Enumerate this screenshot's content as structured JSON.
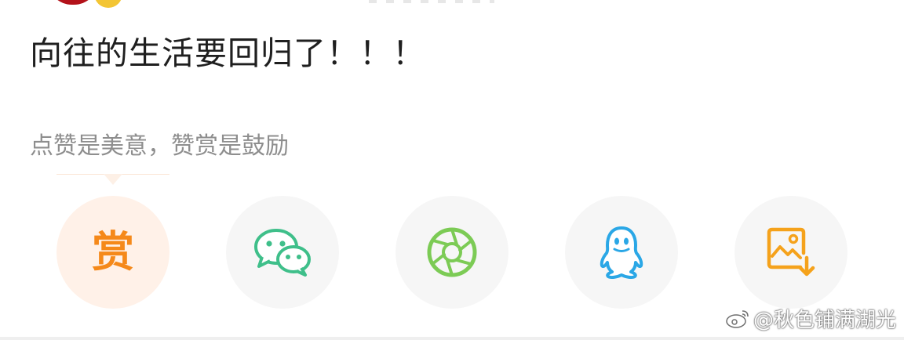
{
  "post": {
    "text": "向往的生活要回归了！！！"
  },
  "reward": {
    "hint": "点赞是美意，赞赏是鼓励",
    "label": "赏"
  },
  "share_actions": [
    {
      "id": "reward",
      "icon": "reward-icon",
      "color": "#f5891a"
    },
    {
      "id": "wechat",
      "icon": "wechat-icon",
      "color": "#3fbf8a"
    },
    {
      "id": "moments",
      "icon": "moments-shutter-icon",
      "color": "#7ccb55"
    },
    {
      "id": "qq",
      "icon": "qq-penguin-icon",
      "color": "#2aa7e6"
    },
    {
      "id": "save-image",
      "icon": "save-image-icon",
      "color": "#f5a21b"
    }
  ],
  "watermark": {
    "text": "@秋色铺满湖光"
  },
  "colors": {
    "reward_bg": "#fff1e8",
    "button_bg": "#f6f6f6",
    "text_primary": "#1f1f1f",
    "text_secondary": "#8e8e8e"
  }
}
